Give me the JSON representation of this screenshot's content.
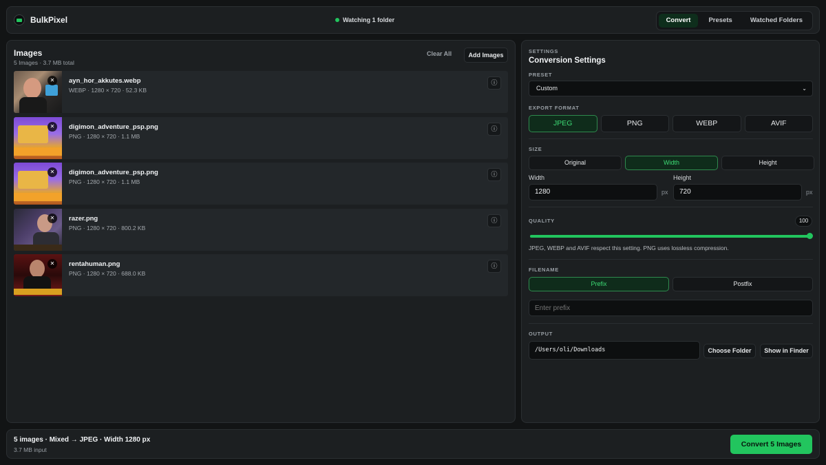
{
  "app": {
    "name": "BulkPixel",
    "status": "Watching 1 folder"
  },
  "colors": {
    "accent": "#22c55e",
    "background": "#121415",
    "panel": "#1c1f21"
  },
  "nav": {
    "tabs": [
      {
        "label": "Convert",
        "active": true
      },
      {
        "label": "Presets",
        "active": false
      },
      {
        "label": "Watched Folders",
        "active": false
      }
    ]
  },
  "images": {
    "title": "Images",
    "summary": "5 Images · 3.7 MB total",
    "clear_label": "Clear All",
    "add_label": "Add Images",
    "remove_icon": "close-icon",
    "info_icon": "info-icon",
    "items": [
      {
        "name": "ayn_hor_akkutes.webp",
        "meta": "WEBP · 1280 × 720 · 52.3 KB"
      },
      {
        "name": "digimon_adventure_psp.png",
        "meta": "PNG · 1280 × 720 · 1.1 MB"
      },
      {
        "name": "digimon_adventure_psp.png",
        "meta": "PNG · 1280 × 720 · 1.1 MB"
      },
      {
        "name": "razer.png",
        "meta": "PNG · 1280 × 720 · 800.2 KB"
      },
      {
        "name": "rentahuman.png",
        "meta": "PNG · 1280 × 720 · 688.0 KB"
      }
    ]
  },
  "settings": {
    "eyebrow": "SETTINGS",
    "title": "Conversion Settings",
    "preset": {
      "label": "PRESET",
      "value": "Custom"
    },
    "export_format": {
      "label": "EXPORT FORMAT",
      "options": [
        "JPEG",
        "PNG",
        "WEBP",
        "AVIF"
      ],
      "selected": "JPEG"
    },
    "size": {
      "label": "SIZE",
      "options": [
        "Original",
        "Width",
        "Height"
      ],
      "selected": "Width",
      "width_label": "Width",
      "width_value": "1280",
      "height_label": "Height",
      "height_value": "720",
      "unit": "px"
    },
    "quality": {
      "label": "QUALITY",
      "value": 100,
      "value_text": "100",
      "hint": "JPEG, WEBP and AVIF respect this setting. PNG uses lossless compression."
    },
    "filename": {
      "label": "FILENAME",
      "options": [
        "Prefix",
        "Postfix"
      ],
      "selected": "Prefix",
      "placeholder": "Enter prefix"
    },
    "output": {
      "label": "OUTPUT",
      "path": "/Users/oli/Downloads",
      "choose_label": "Choose Folder",
      "show_label": "Show in Finder"
    }
  },
  "footer": {
    "summary": "5 images · Mixed → JPEG · Width 1280 px",
    "input_size": "3.7 MB input",
    "convert_label": "Convert 5 Images"
  }
}
